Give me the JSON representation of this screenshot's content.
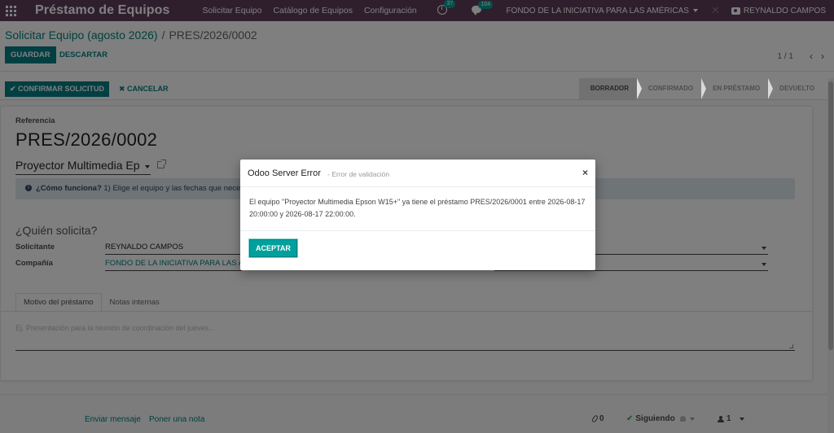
{
  "navbar": {
    "app_name": "Préstamo de Equipos",
    "menu": [
      "Solicitar Equipo",
      "Catálogo de Equipos",
      "Configuración"
    ],
    "activity_count": "37",
    "message_count": "104",
    "company": "FONDO DE LA INICIATIVA PARA LAS AMÉRICAS",
    "user": "REYNALDO CAMPOS"
  },
  "control_panel": {
    "breadcrumb_parent": "Solicitar Equipo (agosto 2026)",
    "breadcrumb_separator": "/",
    "breadcrumb_current": "PRES/2026/0002",
    "save_label": "GUARDAR",
    "discard_label": "DESCARTAR",
    "pager": "1 / 1"
  },
  "statusbar": {
    "confirm_label": "✔ CONFIRMAR SOLICITUD",
    "cancel_label": "✖ CANCELAR",
    "stages": [
      {
        "label": "BORRADOR",
        "active": true
      },
      {
        "label": "CONFIRMADO",
        "active": false
      },
      {
        "label": "EN PRÉSTAMO",
        "active": false
      },
      {
        "label": "DEVUELTO",
        "active": false
      }
    ]
  },
  "form": {
    "reference_label": "Referencia",
    "reference_value": "PRES/2026/0002",
    "equipment_value": "Proyector Multimedia Ep",
    "info_title": "¿Cómo funciona?",
    "info_text": " 1) Elige el equipo y las fechas que necesit",
    "section_title": "¿Quién solicita?",
    "applicant_label": "Solicitante",
    "applicant_value": "REYNALDO CAMPOS",
    "company_label": "Compañía",
    "company_value": "FONDO DE LA INICIATIVA PARA LAS AMÉRICAS",
    "tabs": [
      "Motivo del préstamo",
      "Notas internas"
    ],
    "reason_placeholder": "Ej. Presentación para la reunión de coordinación del jueves..."
  },
  "chatter": {
    "send_message": "Enviar mensaje",
    "log_note": "Poner una nota",
    "attachments": "0",
    "following": "Siguiendo",
    "followers": "1"
  },
  "dialog": {
    "title": "Odoo Server Error",
    "subtitle": "- Error de validación",
    "close": "×",
    "message": "El equipo \"Proyector Multimedia Epson W15+\" ya tiene el préstamo PRES/2026/0001 entre 2026-08-17 20:00:00 y 2026-08-17 22:00:00.",
    "accept_label": "ACEPTAR"
  },
  "colors": {
    "navbar": "#5e3f5b",
    "primary": "#017e84",
    "accent": "#00a09d",
    "link": "#00807d"
  }
}
